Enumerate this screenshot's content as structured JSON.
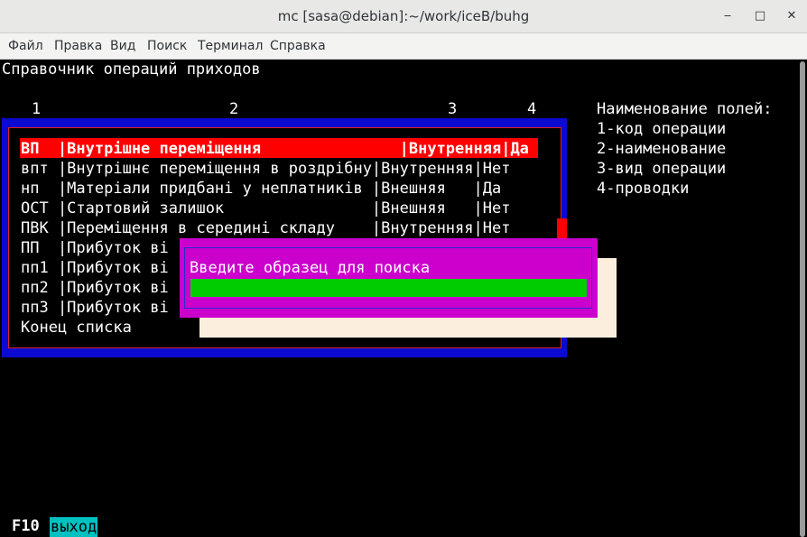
{
  "window": {
    "title": "mc [sasa@debian]:~/work/iceB/buhg",
    "minimize_glyph": "‒",
    "maximize_glyph": "□",
    "close_glyph": "✕"
  },
  "menubar": {
    "items": [
      "Файл",
      "Правка",
      "Вид",
      "Поиск",
      "Терминал",
      "Справка"
    ]
  },
  "screen": {
    "title": "Справочник операций приходов",
    "column_numbers": [
      "1",
      "2",
      "3",
      "4"
    ],
    "legend": {
      "heading": "Наименование полей:",
      "items": [
        "1-код операции",
        "2-наименование",
        "3-вид операции",
        "4-проводки"
      ]
    },
    "rows": [
      "ВП  |Внутрішне переміщення               |Внутренняя|Да",
      "впт |Внутрішнє переміщення в роздрібну|Внутренняя|Нет",
      "нп  |Матеріали придбані у неплатників |Внешняя   |Да",
      "ОСТ |Стартовий залишок                |Внешняя   |Нет",
      "ПВК |Переміщення в середині складу    |Внутренняя|Нет",
      "ПП  |Прибуток ві",
      "пп1 |Прибуток ві",
      "пп2 |Прибуток ві",
      "пп3 |Прибуток ві",
      "Конец списка"
    ],
    "selected_row": 0
  },
  "dialog": {
    "prompt": "Введите образец для поиска",
    "input_value": ""
  },
  "footer": {
    "key": "F10",
    "action": "выход"
  },
  "colors": {
    "list_frame": "#0a0ad0",
    "selection": "#ff0000",
    "dialog": "#cc00cc",
    "input": "#00cc00",
    "footer_action": "#00c0c0"
  }
}
